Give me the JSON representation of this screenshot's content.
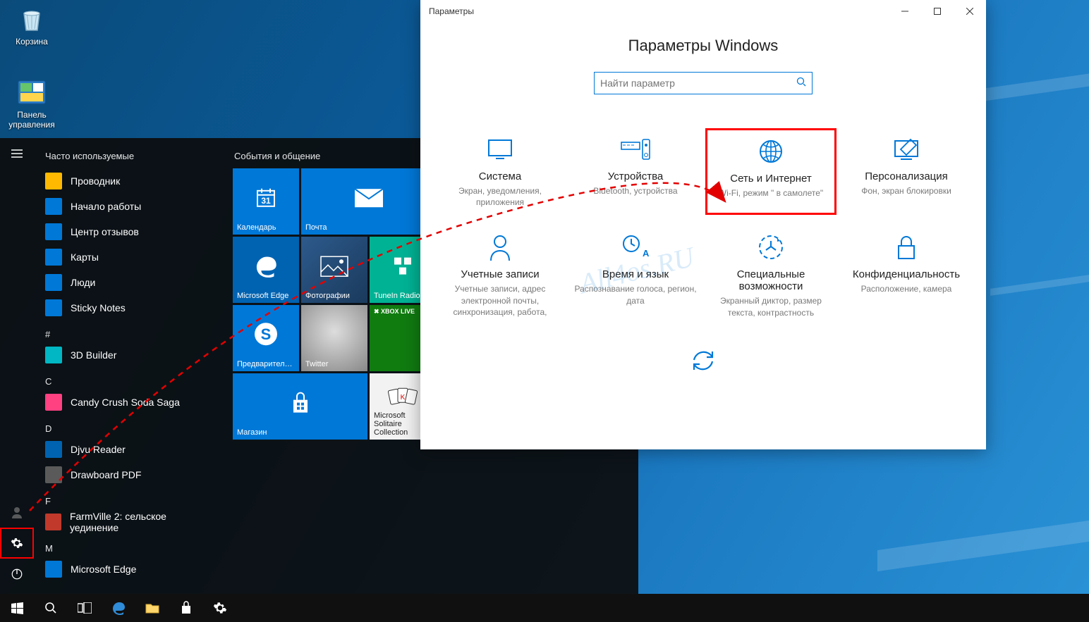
{
  "desktop": {
    "icons": [
      {
        "name": "recycle-bin",
        "label": "Корзина"
      },
      {
        "name": "control-panel",
        "label": "Панель управления"
      }
    ]
  },
  "start_menu": {
    "recent_header": "Часто используемые",
    "recent": [
      {
        "label": "Проводник",
        "color": "#ffb900",
        "icon": "folder"
      },
      {
        "label": "Начало работы",
        "color": "#0078d7",
        "icon": "flag"
      },
      {
        "label": "Центр отзывов",
        "color": "#0078d7",
        "icon": "chat"
      },
      {
        "label": "Карты",
        "color": "#0078d7",
        "icon": "cam"
      },
      {
        "label": "Люди",
        "color": "#0078d7",
        "icon": "people"
      },
      {
        "label": "Sticky Notes",
        "color": "#0078d7",
        "icon": "note"
      }
    ],
    "alpha": [
      {
        "letter": "#",
        "items": [
          {
            "label": "3D Builder",
            "color": "#00b7c3"
          }
        ]
      },
      {
        "letter": "C",
        "items": [
          {
            "label": "Candy Crush Soda Saga",
            "color": "#ff4081"
          }
        ]
      },
      {
        "letter": "D",
        "items": [
          {
            "label": "Djvu Reader",
            "color": "#0063b1"
          },
          {
            "label": "Drawboard PDF",
            "color": "#5a5a5a"
          }
        ]
      },
      {
        "letter": "F",
        "items": [
          {
            "label": "FarmVille 2: сельское уединение",
            "color": "#c0392b"
          }
        ]
      },
      {
        "letter": "M",
        "items": [
          {
            "label": "Microsoft Edge",
            "color": "#0078d7"
          }
        ]
      }
    ],
    "tiles_header": "События и общение",
    "tiles": [
      {
        "label": "Календарь",
        "size": "med",
        "bg": "bg-blue",
        "icon": "calendar"
      },
      {
        "label": "Почта",
        "size": "wide",
        "bg": "bg-blue",
        "icon": "mail"
      },
      {
        "label": "Microsoft Edge",
        "size": "med",
        "bg": "bg-dkblue",
        "icon": "edge"
      },
      {
        "label": "Фотографии",
        "size": "med",
        "bg": "bg-photo",
        "icon": "photos"
      },
      {
        "label": "TuneIn Radio",
        "size": "med",
        "bg": "bg-teal",
        "icon": "tunein"
      },
      {
        "label": "Предварител…",
        "size": "med",
        "bg": "bg-blue",
        "icon": "skype"
      },
      {
        "label": "Twitter",
        "size": "med",
        "bg": "bg-black",
        "icon": "twitter"
      },
      {
        "label": "",
        "size": "med",
        "bg": "bg-xbox",
        "icon": "xboxlive",
        "sublabel": "XBOX LIVE"
      },
      {
        "label": "Магазин",
        "size": "wide",
        "bg": "bg-blue",
        "icon": "store"
      },
      {
        "label": "Microsoft Solitaire Collection",
        "size": "med",
        "bg": "bg-cards",
        "icon": "cards"
      }
    ]
  },
  "settings": {
    "window_title": "Параметры",
    "page_title": "Параметры Windows",
    "search_placeholder": "Найти параметр",
    "categories": [
      {
        "id": "system",
        "title": "Система",
        "desc": "Экран, уведомления, приложения",
        "icon": "display"
      },
      {
        "id": "devices",
        "title": "Устройства",
        "desc": "Bluetooth, устройства",
        "icon": "devices"
      },
      {
        "id": "network",
        "title": "Сеть и Интернет",
        "desc": "Wi-Fi, режим \" в самолете\"",
        "icon": "globe",
        "highlight": true
      },
      {
        "id": "personalize",
        "title": "Персонализация",
        "desc": "Фон, экран блокировки",
        "icon": "personalize"
      },
      {
        "id": "accounts",
        "title": "Учетные записи",
        "desc": "Учетные записи, адрес электронной почты, синхронизация, работа,",
        "icon": "accounts"
      },
      {
        "id": "timelang",
        "title": "Время и язык",
        "desc": "Распознавание голоса, регион, дата",
        "icon": "timelang"
      },
      {
        "id": "ease",
        "title": "Специальные возможности",
        "desc": "Экранный диктор, размер текста, контрастность",
        "icon": "ease"
      },
      {
        "id": "privacy",
        "title": "Конфиденциальность",
        "desc": "Расположение, камера",
        "icon": "privacy"
      }
    ],
    "categories_row3": [
      {
        "id": "update",
        "title": "",
        "desc": "",
        "icon": "update"
      }
    ]
  },
  "watermark": "All4os.RU"
}
